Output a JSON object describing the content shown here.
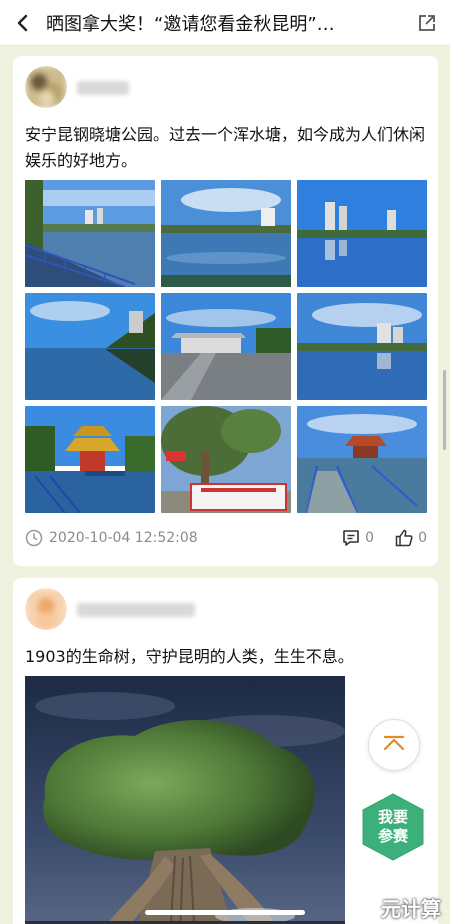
{
  "header": {
    "title": "晒图拿大奖！“邀请您看金秋昆明”…",
    "back_icon": "chevron-left-icon",
    "share_icon": "external-link-icon"
  },
  "posts": [
    {
      "text": "安宁昆钢晓塘公园。过去一个浑水塘，如今成为人们休闲娱乐的好地方。",
      "timestamp": "2020-10-04 12:52:08",
      "comment_count": "0",
      "like_count": "0",
      "photos": [
        "lake-walkway",
        "lake-buildings",
        "lake-reflection",
        "lake-trees",
        "lakeside-pavilion-path",
        "lake-towers",
        "pagoda-pavilion",
        "banyan-tree-sign",
        "lake-bridge-pavilion"
      ]
    },
    {
      "text": "1903的生命树，守护昆明的人类，生生不息。"
    }
  ],
  "floating": {
    "scroll_top_icon": "chevron-up-icon",
    "join_label": "我要参赛",
    "join_color": "#3cb07a"
  },
  "watermark": "元计算"
}
